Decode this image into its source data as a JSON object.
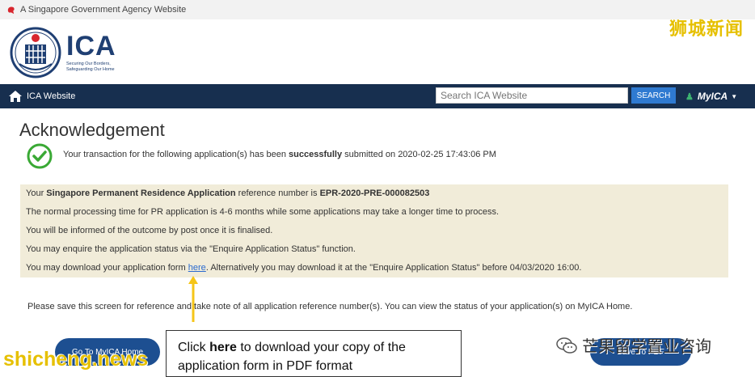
{
  "gov_bar": {
    "text": "A Singapore Government Agency Website"
  },
  "watermarks": {
    "top_right": "狮城新闻",
    "bottom_left": "shicheng.news",
    "bottom_right": "芒果留学置业咨询"
  },
  "logo": {
    "name": "ICA",
    "tagline_1": "Securing Our Borders,",
    "tagline_2": "Safeguarding Our Home"
  },
  "nav": {
    "home_label": "ICA Website",
    "search_placeholder": "Search ICA Website",
    "search_button": "SEARCH",
    "myica_label": "MyICA"
  },
  "page": {
    "title": "Acknowledgement",
    "success": {
      "prefix": "Your transaction for the following application(s) has been ",
      "bold": "successfully",
      "suffix": " submitted on 2020-02-25 17:43:06 PM"
    }
  },
  "info": {
    "line1_prefix": "Your ",
    "line1_app": "Singapore Permanent Residence Application",
    "line1_middle": " reference number is ",
    "line1_ref": "EPR-2020-PRE-000082503",
    "line2": "The normal processing time for PR application is 4-6 months while some applications may take a longer time to process.",
    "line3": "You will be informed of the outcome by post once it is finalised.",
    "line4": "You may enquire the application status via the \"Enquire Application Status\" function.",
    "line5_prefix": "You may download your application form ",
    "line5_link": "here",
    "line5_suffix": ". Alternatively you may download it at the \"Enquire Application Status\" before 04/03/2020 16:00."
  },
  "save_note": "Please save this screen for reference and take note of all application reference number(s). You can view the status of your application(s) on MyICA Home.",
  "buttons": {
    "home": "Go To MyICA Home",
    "pdf": "Save To PDF"
  },
  "callout": {
    "prefix": "Click ",
    "bold": "here",
    "line1_suffix": " to download your copy of the",
    "line2": "application form in PDF format"
  },
  "colors": {
    "nav_bg": "#172f4f",
    "accent_blue": "#2f7ad1",
    "info_bg": "#f1ecd9",
    "success_green": "#3aa935",
    "arrow_yellow": "#f5c518",
    "watermark_yellow": "#e6c000"
  },
  "icons": [
    "lion-head-icon",
    "ica-crest-icon",
    "home-icon",
    "user-icon",
    "caret-down-icon",
    "checkmark-circle-icon",
    "arrow-up-icon",
    "wechat-icon"
  ]
}
